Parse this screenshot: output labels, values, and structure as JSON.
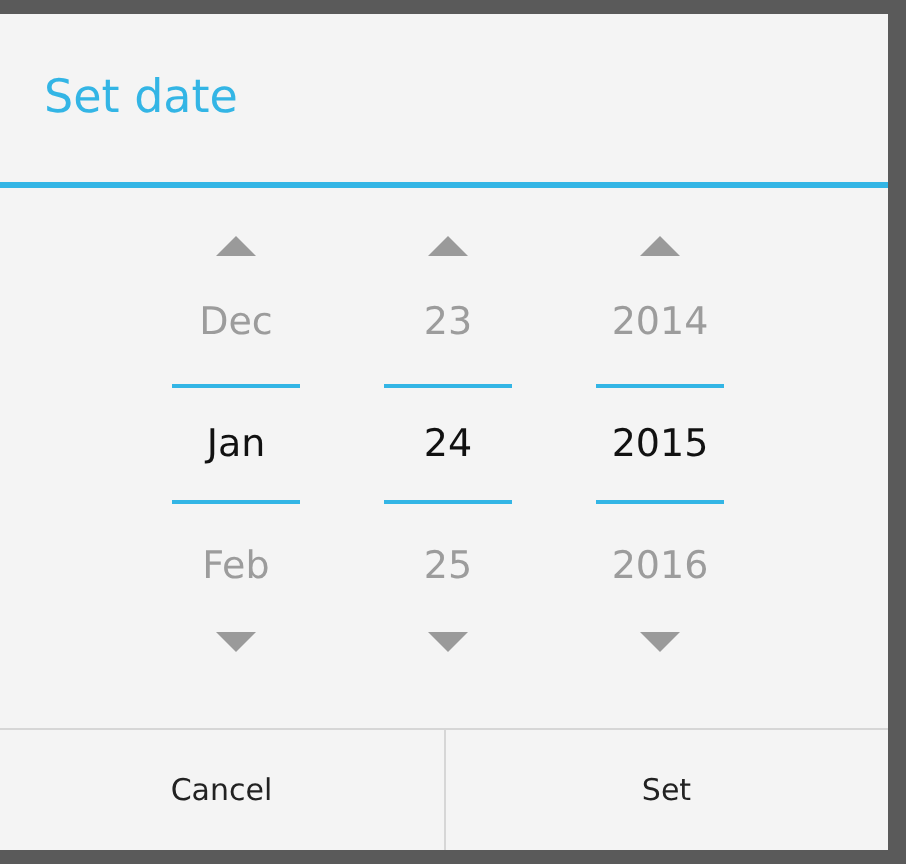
{
  "dialog": {
    "title": "Set date"
  },
  "pickers": [
    {
      "previous": "Dec",
      "value": "Jan",
      "next": "Feb"
    },
    {
      "previous": "23",
      "value": "24",
      "next": "25"
    },
    {
      "previous": "2014",
      "value": "2015",
      "next": "2016"
    }
  ],
  "buttons": [
    "Cancel",
    "Set"
  ]
}
